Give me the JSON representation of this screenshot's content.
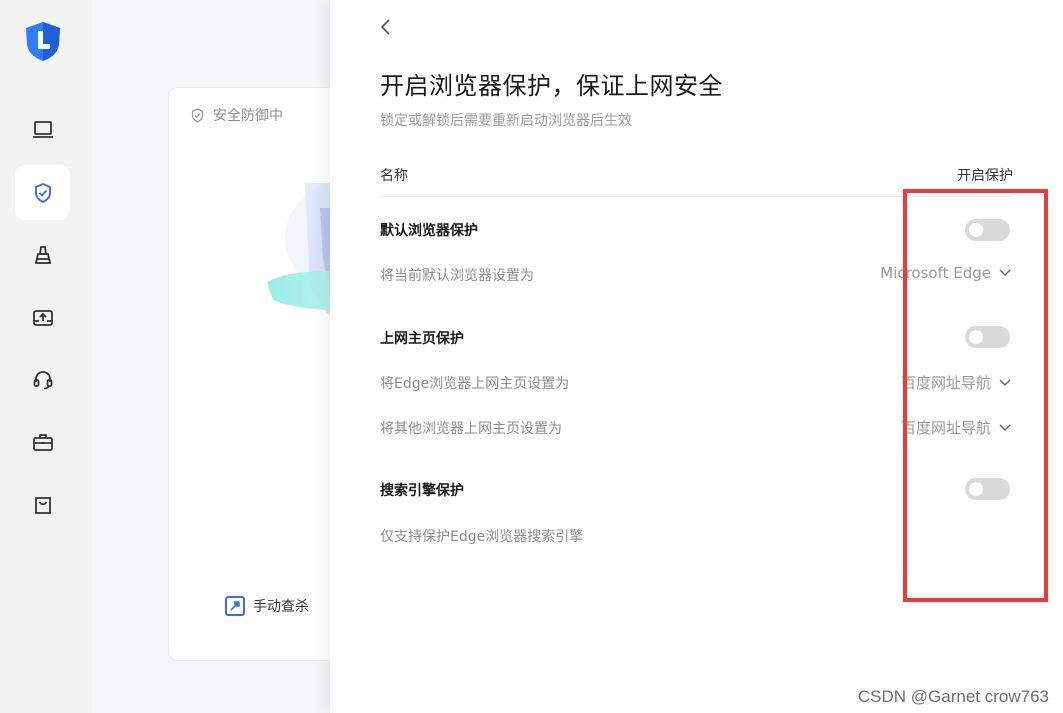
{
  "sidebar": {
    "items": [
      {
        "name": "computer"
      },
      {
        "name": "shield-check",
        "active": true
      },
      {
        "name": "cleanup"
      },
      {
        "name": "drive-upload"
      },
      {
        "name": "headset-support"
      },
      {
        "name": "toolbox"
      },
      {
        "name": "shopping-bag"
      }
    ]
  },
  "background": {
    "status_text": "安全防御中",
    "manual_scan_label": "手动查杀"
  },
  "panel": {
    "title": "开启浏览器保护，保证上网安全",
    "subtitle": "锁定或解锁后需要重新启动浏览器后生效",
    "columns": {
      "name": "名称",
      "protection": "开启保护"
    },
    "sections": [
      {
        "title": "默认浏览器保护",
        "enabled": false,
        "sub_label": "将当前默认浏览器设置为",
        "select_value": "Microsoft Edge"
      },
      {
        "title": "上网主页保护",
        "enabled": false,
        "sub_label_1": "将Edge浏览器上网主页设置为",
        "select_value_1": "百度网址导航",
        "sub_label_2": "将其他浏览器上网主页设置为",
        "select_value_2": "百度网址导航"
      },
      {
        "title": "搜索引擎保护",
        "enabled": false,
        "sub_label": "仅支持保护Edge浏览器搜索引擎"
      }
    ]
  },
  "watermark": "CSDN @Garnet crow763",
  "colors": {
    "accent": "#3f6de0",
    "highlight": "#ee3a3a",
    "toggle_off": "#d9d9d9"
  }
}
